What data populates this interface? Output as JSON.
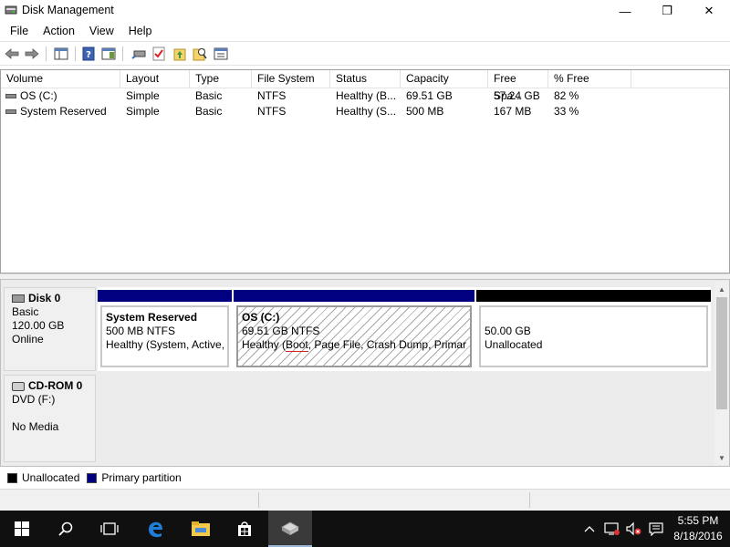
{
  "window": {
    "title": "Disk Management",
    "controls": {
      "minimize": "—",
      "maximize": "❐",
      "close": "✕"
    }
  },
  "menu": [
    "File",
    "Action",
    "View",
    "Help"
  ],
  "toolbar": {
    "icons": [
      "back-arrow-icon",
      "forward-arrow-icon",
      "console-tree-icon",
      "help-icon",
      "action-pane-icon",
      "connect-disk-icon",
      "check-icon",
      "up-folder-icon",
      "find-icon",
      "properties-icon"
    ]
  },
  "volume_table": {
    "columns": [
      "Volume",
      "Layout",
      "Type",
      "File System",
      "Status",
      "Capacity",
      "Free Spa...",
      "% Free"
    ],
    "rows": [
      {
        "volume": "OS (C:)",
        "layout": "Simple",
        "type": "Basic",
        "fs": "NTFS",
        "status": "Healthy (B...",
        "capacity": "69.51 GB",
        "free": "57.24 GB",
        "pct": "82 %"
      },
      {
        "volume": "System Reserved",
        "layout": "Simple",
        "type": "Basic",
        "fs": "NTFS",
        "status": "Healthy (S...",
        "capacity": "500 MB",
        "free": "167 MB",
        "pct": "33 %"
      }
    ]
  },
  "disks": [
    {
      "name": "Disk 0",
      "type": "Basic",
      "size": "120.00 GB",
      "state": "Online",
      "partitions": [
        {
          "title": "System Reserved",
          "size": "500 MB NTFS",
          "status": "Healthy (System, Active,",
          "bar_color": "#000080"
        },
        {
          "title": "OS  (C:)",
          "size": "69.51 GB NTFS",
          "status_prefix": "Healthy (",
          "status_underlined": "Boot",
          "status_suffix": ", Page File, Crash Dump, Primary I",
          "bar_color": "#000080"
        },
        {
          "title": "",
          "size": "50.00 GB",
          "status": "Unallocated",
          "bar_color": "#000000"
        }
      ]
    },
    {
      "name": "CD-ROM 0",
      "type": "DVD (F:)",
      "state": "No Media"
    }
  ],
  "legend": [
    {
      "label": "Unallocated",
      "color": "#000000"
    },
    {
      "label": "Primary partition",
      "color": "#000080"
    }
  ],
  "taskbar": {
    "clock_time": "5:55 PM",
    "clock_date": "8/18/2016",
    "items": [
      "start-icon",
      "search-icon",
      "task-view-icon",
      "edge-icon",
      "file-explorer-icon",
      "store-icon",
      "disk-management-icon"
    ],
    "tray": [
      "chevron-up-icon",
      "network-icon",
      "volume-muted-icon",
      "notification-icon"
    ]
  }
}
